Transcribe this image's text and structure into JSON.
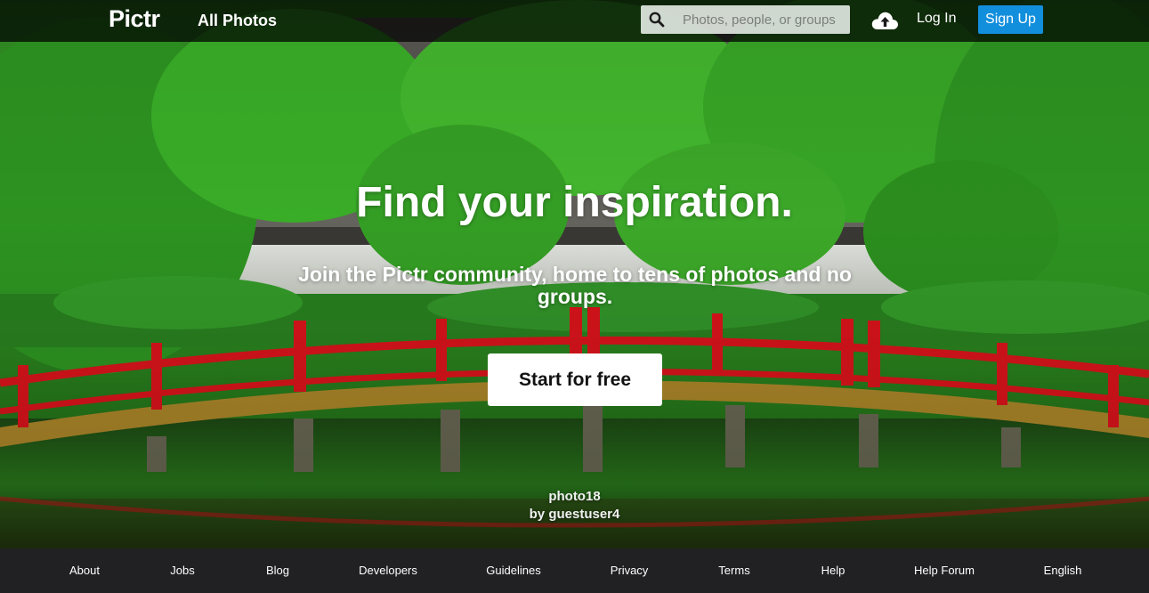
{
  "header": {
    "logo": "Pictr",
    "nav_all_photos": "All Photos",
    "search_placeholder": "Photos, people, or groups",
    "login_label": "Log In",
    "signup_label": "Sign Up",
    "upload_icon": "cloud-upload-icon",
    "search_icon": "magnifier-icon"
  },
  "hero": {
    "title": "Find your inspiration.",
    "subtitle": "Join the Pictr community, home to tens of photos and no groups.",
    "cta_label": "Start for free",
    "photo_title": "photo18",
    "photo_author": "by guestuser4"
  },
  "footer": {
    "links": [
      "About",
      "Jobs",
      "Blog",
      "Developers",
      "Guidelines",
      "Privacy",
      "Terms",
      "Help",
      "Help Forum",
      "English"
    ]
  },
  "colors": {
    "signup_button": "#128fdc",
    "footer_bg": "#212124",
    "bridge_red": "#e0141c"
  }
}
